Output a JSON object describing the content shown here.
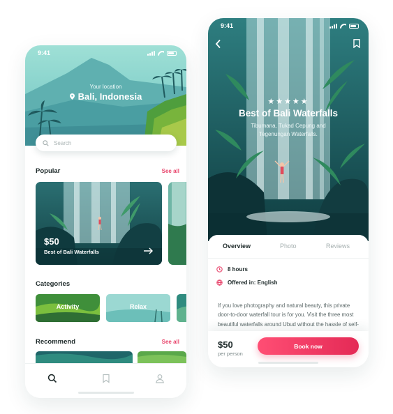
{
  "left_screen": {
    "status_time": "9:41",
    "location_caption": "Your location",
    "location_name": "Bali, Indonesia",
    "search": {
      "placeholder": "Search"
    },
    "popular": {
      "title": "Popular",
      "see_all": "See all",
      "card": {
        "price": "$50",
        "name": "Best of Bali Waterfalls"
      }
    },
    "categories": {
      "title": "Categories",
      "items": [
        "Activity",
        "Relax"
      ]
    },
    "recommend": {
      "title": "Recommend",
      "see_all": "See all"
    },
    "tab_bar": [
      "search-icon",
      "bookmark-icon",
      "profile-icon"
    ]
  },
  "right_screen": {
    "status_time": "9:41",
    "rating_stars": "★★★★★",
    "title": "Best of Bali Waterfalls",
    "subtitle": "Tibumana, Tukad Cepung and Tegenungan Waterfalls.",
    "tabs": [
      "Overview",
      "Photo",
      "Reviews"
    ],
    "active_tab": "Overview",
    "duration": "8 hours",
    "language": "Offered in: English",
    "description": "If you love photography and natural beauty, this private door-to-door waterfall tour is for you. Visit the three most beautiful waterfalls around Ubud without the hassle of self-drive: Tibumana Waterfall, nestled",
    "price": "$50",
    "per_person": "per person",
    "book_button": "Book now"
  },
  "colors": {
    "accent": "#e8456c",
    "teal_dark": "#1b5a5c",
    "teal_light": "#7fc9c6",
    "green": "#3f9a4a"
  }
}
